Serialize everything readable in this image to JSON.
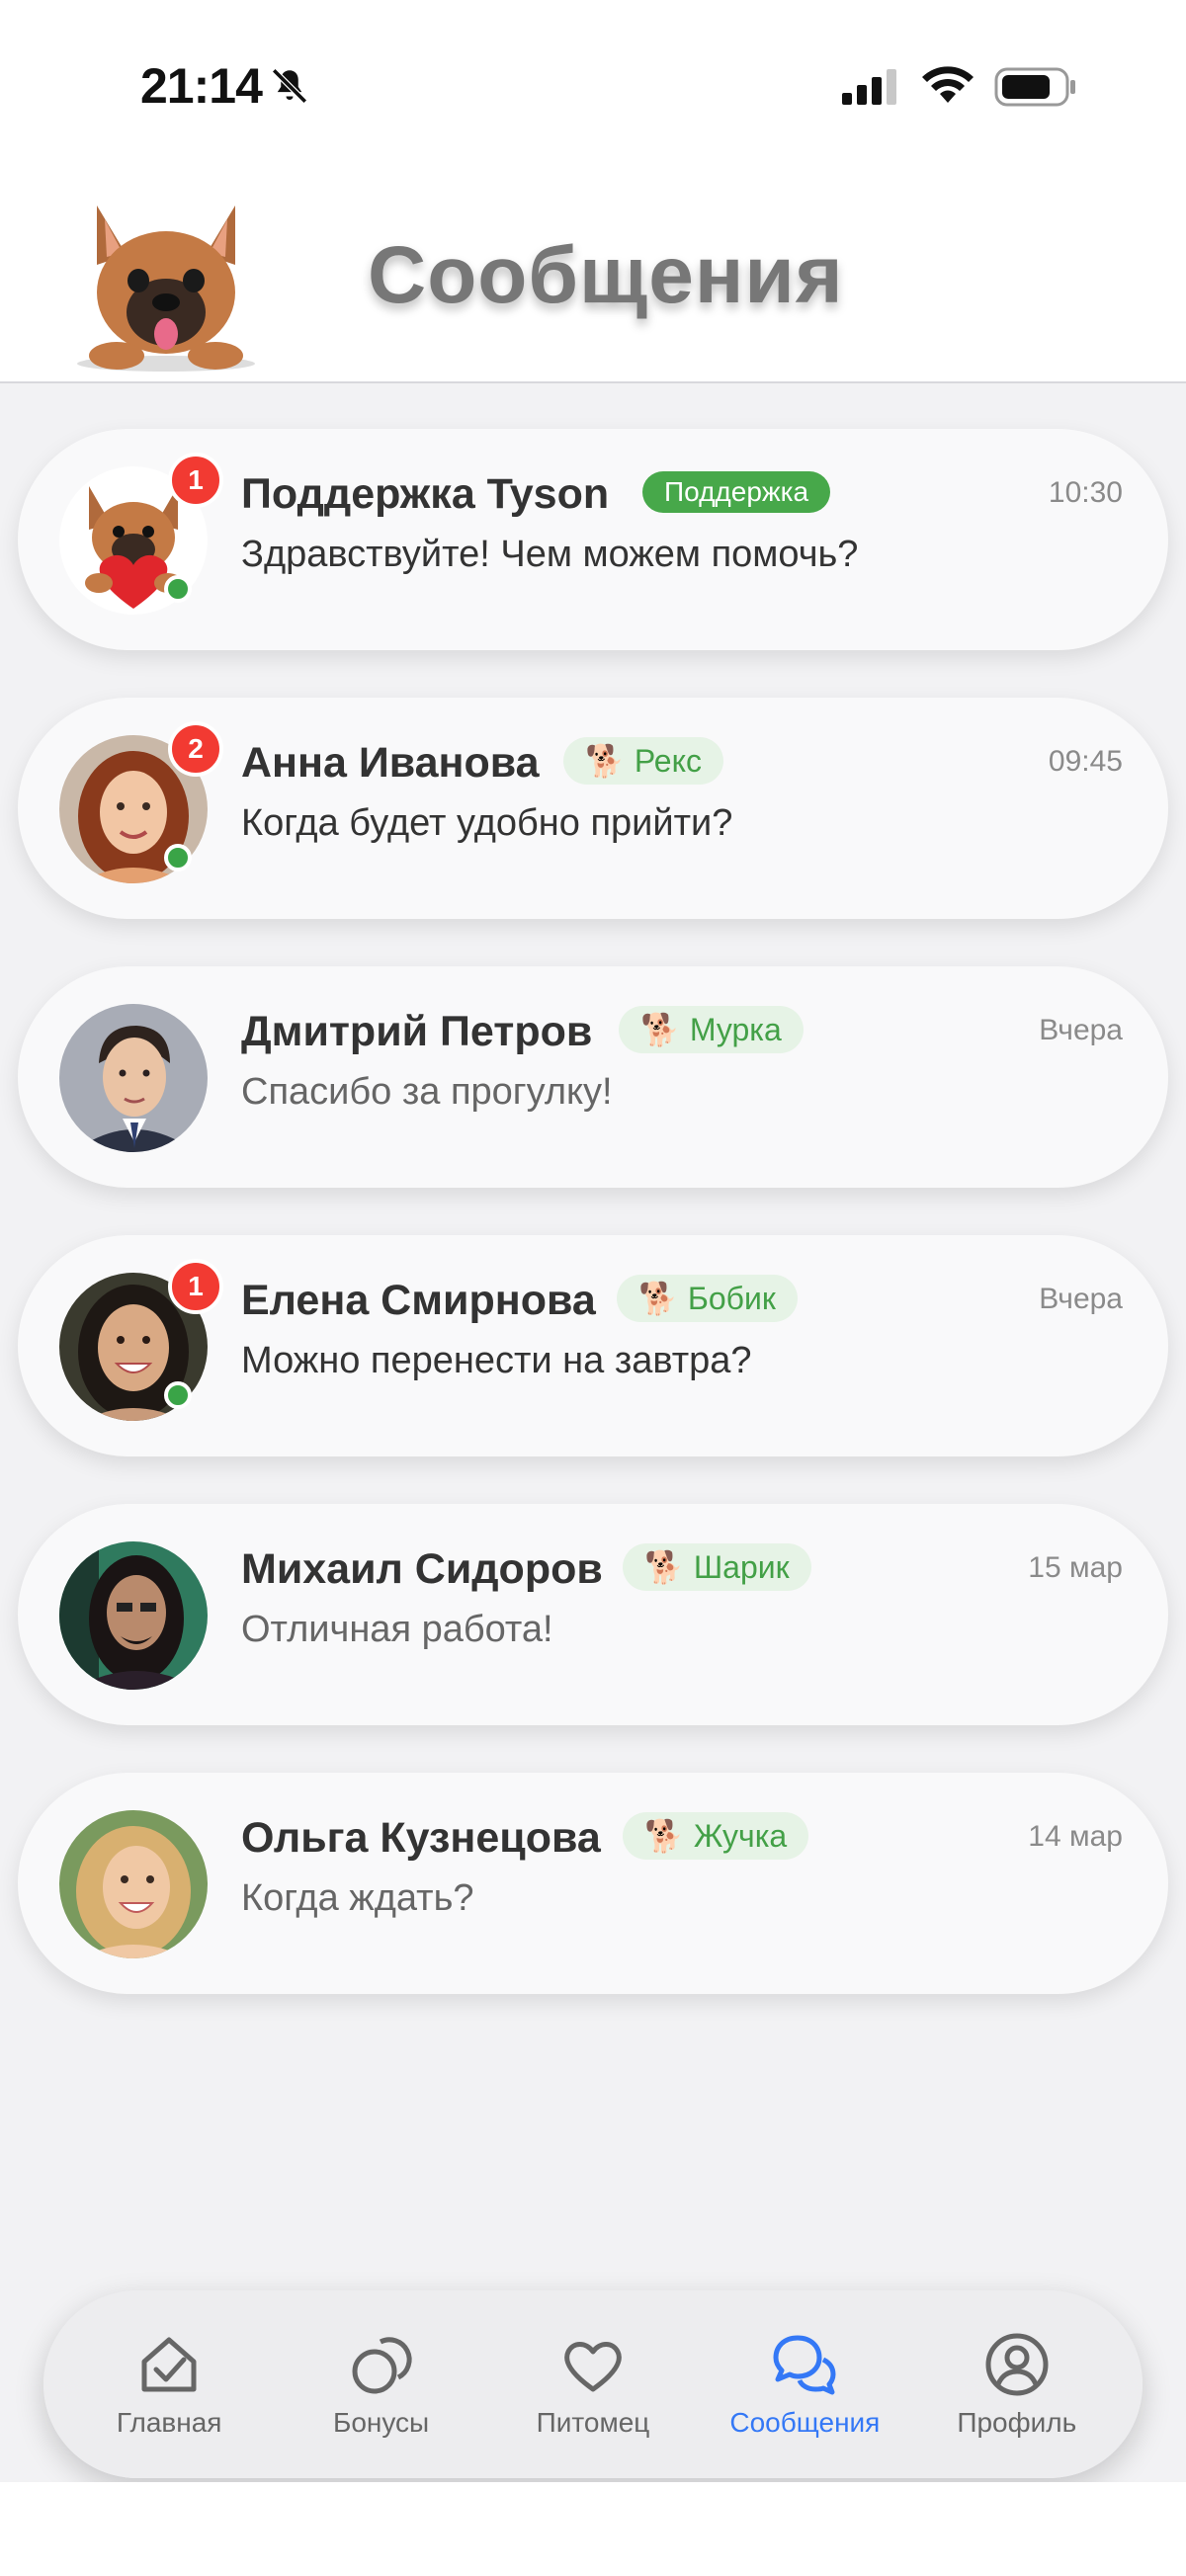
{
  "status": {
    "time": "21:14"
  },
  "header": {
    "title": "Сообщения"
  },
  "chats": [
    {
      "name": "Поддержка Tyson",
      "tag": "Поддержка",
      "tag_type": "support",
      "time": "10:30",
      "message": "Здравствуйте! Чем можем помочь?",
      "unread": "1",
      "online": true,
      "avatar": "dog-heart"
    },
    {
      "name": "Анна Иванова",
      "tag": "Рекс",
      "tag_type": "pet",
      "tag_emoji": "🐕",
      "time": "09:45",
      "message": "Когда будет удобно прийти?",
      "unread": "2",
      "online": true,
      "avatar": "woman-red-hair"
    },
    {
      "name": "Дмитрий Петров",
      "tag": "Мурка",
      "tag_type": "pet",
      "tag_emoji": "🐕",
      "time": "Вчера",
      "message": "Спасибо за прогулку!",
      "unread": "",
      "online": false,
      "avatar": "man-suit"
    },
    {
      "name": "Елена Смирнова",
      "tag": "Бобик",
      "tag_type": "pet",
      "tag_emoji": "🐕",
      "time": "Вчера",
      "message": "Можно перенести на завтра?",
      "unread": "1",
      "online": true,
      "avatar": "woman-dark-hair"
    },
    {
      "name": "Михаил Сидоров",
      "tag": "Шарик",
      "tag_type": "pet",
      "tag_emoji": "🐕",
      "time": "15 мар",
      "message": "Отличная работа!",
      "unread": "",
      "online": false,
      "avatar": "man-long-hair"
    },
    {
      "name": "Ольга Кузнецова",
      "tag": "Жучка",
      "tag_type": "pet",
      "tag_emoji": "🐕",
      "time": "14 мар",
      "message": "Когда ждать?",
      "unread": "",
      "online": false,
      "avatar": "woman-blonde"
    }
  ],
  "nav": [
    {
      "label": "Главная",
      "icon": "home-check-icon",
      "active": false
    },
    {
      "label": "Бонусы",
      "icon": "coins-icon",
      "active": false
    },
    {
      "label": "Питомец",
      "icon": "heart-icon",
      "active": false
    },
    {
      "label": "Сообщения",
      "icon": "chat-bubbles-icon",
      "active": true
    },
    {
      "label": "Профиль",
      "icon": "profile-icon",
      "active": false
    }
  ],
  "colors": {
    "accent": "#3478f6",
    "online": "#3aa447",
    "badge": "#f23a32",
    "tag_green": "#43a047"
  }
}
